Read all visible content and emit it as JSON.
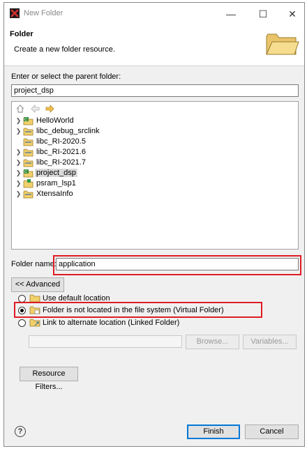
{
  "window": {
    "title": "New Folder"
  },
  "header": {
    "title": "Folder",
    "description": "Create a new folder resource."
  },
  "parent": {
    "label": "Enter or select the parent folder:",
    "value": "project_dsp",
    "tree": [
      {
        "label": "HelloWorld",
        "expandable": true,
        "selected": false
      },
      {
        "label": "libc_debug_srclink",
        "expandable": true,
        "selected": false
      },
      {
        "label": "libc_RI-2020.5",
        "expandable": false,
        "selected": false
      },
      {
        "label": "libc_RI-2021.6",
        "expandable": true,
        "selected": false
      },
      {
        "label": "libc_RI-2021.7",
        "expandable": true,
        "selected": false
      },
      {
        "label": "project_dsp",
        "expandable": true,
        "selected": true
      },
      {
        "label": "psram_lsp1",
        "expandable": true,
        "selected": false
      },
      {
        "label": "XtensaInfo",
        "expandable": true,
        "selected": false
      }
    ]
  },
  "folder_name": {
    "label": "Folder name:",
    "value": "application"
  },
  "advanced": {
    "button_label": "<< Advanced",
    "options": [
      {
        "label": "Use default location",
        "checked": false
      },
      {
        "label": "Folder is not located in the file system (Virtual Folder)",
        "checked": true
      },
      {
        "label": "Link to alternate location (Linked Folder)",
        "checked": false
      }
    ],
    "location_value": "",
    "browse_label": "Browse...",
    "variables_label": "Variables..."
  },
  "resource_filters_label": "Resource Filters...",
  "footer": {
    "help_symbol": "?",
    "finish_label": "Finish",
    "cancel_label": "Cancel"
  },
  "colors": {
    "highlight": "#e01b24",
    "selection": "#d9d9d9",
    "focus": "#0078d7"
  }
}
